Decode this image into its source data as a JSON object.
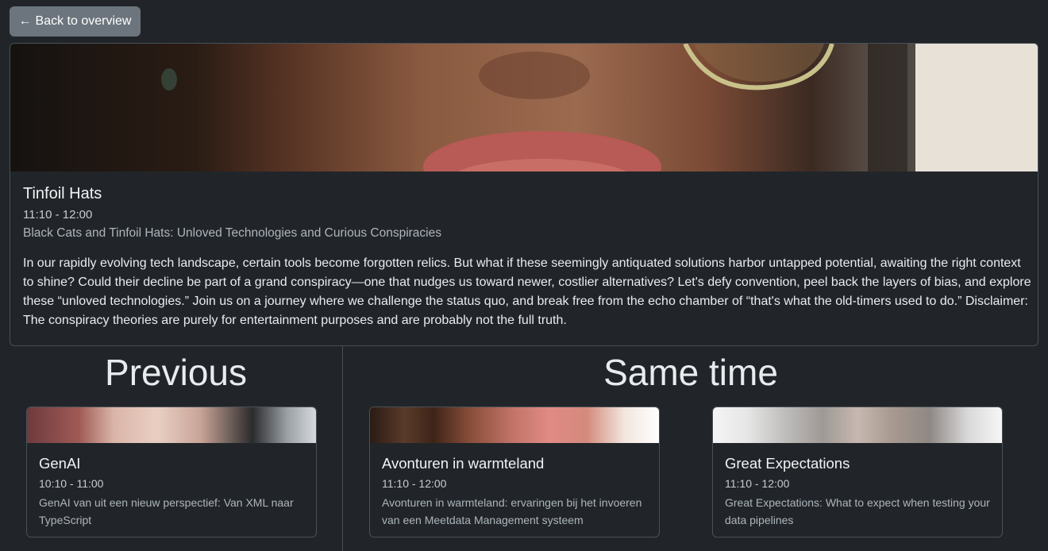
{
  "nav": {
    "back_label": "Back to overview",
    "back_icon": "arrow-left-icon"
  },
  "talk": {
    "title": "Tinfoil Hats",
    "time": "11:10 - 12:00",
    "subtitle": "Black Cats and Tinfoil Hats: Unloved Technologies and Curious Conspiracies",
    "description": "In our rapidly evolving tech landscape, certain tools become forgotten relics. But what if these seemingly antiquated solutions harbor untapped potential, awaiting the right context to shine? Could their decline be part of a grand conspiracy—one that nudges us toward newer, costlier alternatives? Let's defy convention, peel back the layers of bias, and explore these “unloved technologies.” Join us on a journey where we challenge the status quo, and break free from the echo chamber of “that's what the old-timers used to do.” Disclaimer: The conspiracy theories are purely for entertainment purposes and are probably not the full truth."
  },
  "previous": {
    "heading": "Previous",
    "cards": [
      {
        "title": "GenAI",
        "time": "10:10 - 11:00",
        "description": "GenAI van uit een nieuw perspectief: Van XML naar TypeScript"
      }
    ]
  },
  "same_time": {
    "heading": "Same time",
    "cards": [
      {
        "title": "Avonturen in warmteland",
        "time": "11:10 - 12:00",
        "description": "Avonturen in warmteland: ervaringen bij het invoeren van een Meetdata Management systeem"
      },
      {
        "title": "Great Expectations",
        "time": "11:10 - 12:00",
        "description": "Great Expectations: What to expect when testing your data pipelines"
      }
    ]
  },
  "colors": {
    "background": "#212529",
    "border": "#495057",
    "button": "#6c757d"
  }
}
